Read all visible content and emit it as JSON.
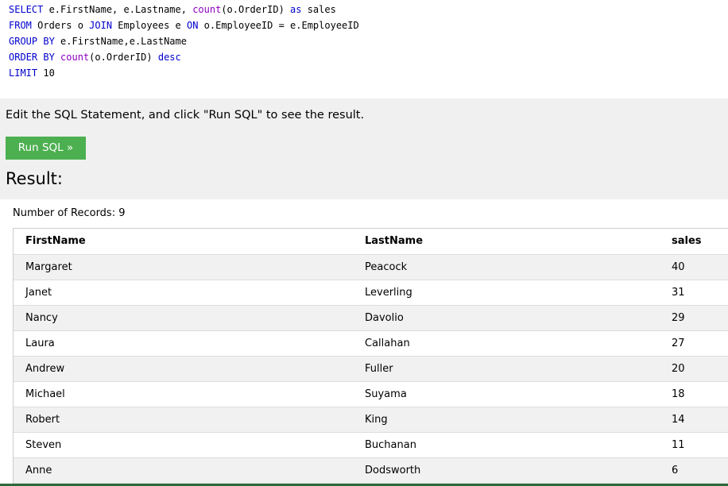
{
  "editor": {
    "lines": [
      [
        {
          "t": "SELECT",
          "c": "kw"
        },
        {
          "t": " e.FirstName, e.Lastname, ",
          "c": ""
        },
        {
          "t": "count",
          "c": "fn"
        },
        {
          "t": "(o.OrderID) ",
          "c": ""
        },
        {
          "t": "as",
          "c": "kw"
        },
        {
          "t": " sales",
          "c": ""
        }
      ],
      [
        {
          "t": "FROM",
          "c": "kw"
        },
        {
          "t": " Orders o ",
          "c": ""
        },
        {
          "t": "JOIN",
          "c": "kw"
        },
        {
          "t": " Employees e ",
          "c": ""
        },
        {
          "t": "ON",
          "c": "kw"
        },
        {
          "t": " o.EmployeeID = e.EmployeeID",
          "c": ""
        }
      ],
      [
        {
          "t": "GROUP BY",
          "c": "kw"
        },
        {
          "t": " e.FirstName,e.LastName",
          "c": ""
        }
      ],
      [
        {
          "t": "ORDER BY",
          "c": "kw"
        },
        {
          "t": " ",
          "c": ""
        },
        {
          "t": "count",
          "c": "fn"
        },
        {
          "t": "(o.OrderID) ",
          "c": ""
        },
        {
          "t": "desc",
          "c": "kw"
        }
      ],
      [
        {
          "t": "LIMIT",
          "c": "kw"
        },
        {
          "t": " 10",
          "c": "num"
        }
      ]
    ]
  },
  "instruction": "Edit the SQL Statement, and click \"Run SQL\" to see the result.",
  "run_button": "Run SQL »",
  "result_heading": "Result:",
  "records_text": "Number of Records: 9",
  "table": {
    "headers": [
      "FirstName",
      "LastName",
      "sales"
    ],
    "rows": [
      [
        "Margaret",
        "Peacock",
        "40"
      ],
      [
        "Janet",
        "Leverling",
        "31"
      ],
      [
        "Nancy",
        "Davolio",
        "29"
      ],
      [
        "Laura",
        "Callahan",
        "27"
      ],
      [
        "Andrew",
        "Fuller",
        "20"
      ],
      [
        "Michael",
        "Suyama",
        "18"
      ],
      [
        "Robert",
        "King",
        "14"
      ],
      [
        "Steven",
        "Buchanan",
        "11"
      ],
      [
        "Anne",
        "Dodsworth",
        "6"
      ]
    ]
  },
  "colors": {
    "button_green": "#4caf50",
    "keyword_blue": "#0000cd",
    "function_purple": "#8b00c0",
    "stripe": "#f1f1f1"
  }
}
